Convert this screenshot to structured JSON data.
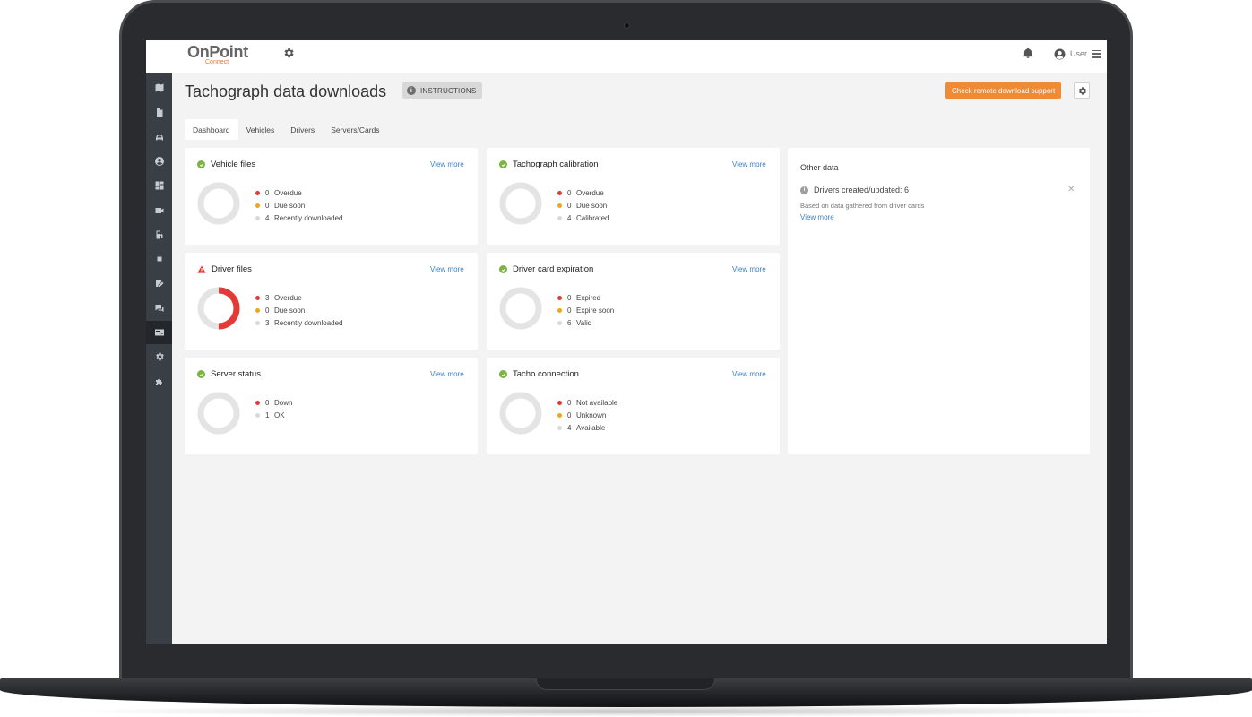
{
  "app": {
    "logo_main": "OnPoint",
    "logo_sub": "Connect"
  },
  "topbar": {
    "user_label": "User"
  },
  "sidebar": {
    "items": [
      {
        "name": "map-icon"
      },
      {
        "name": "document-icon"
      },
      {
        "name": "car-icon"
      },
      {
        "name": "person-icon"
      },
      {
        "name": "dashboard-icon"
      },
      {
        "name": "video-icon"
      },
      {
        "name": "fuel-icon"
      },
      {
        "name": "chip-icon"
      },
      {
        "name": "edit-icon"
      },
      {
        "name": "chat-icon"
      },
      {
        "name": "tachograph-icon",
        "active": true
      },
      {
        "name": "gear-icon"
      },
      {
        "name": "puzzle-icon"
      }
    ]
  },
  "page": {
    "title": "Tachograph data downloads",
    "instructions_label": "INSTRUCTIONS",
    "remote_button_label": "Check remote download support"
  },
  "tabs": [
    {
      "label": "Dashboard",
      "active": true
    },
    {
      "label": "Vehicles",
      "active": false
    },
    {
      "label": "Drivers",
      "active": false
    },
    {
      "label": "Servers/Cards",
      "active": false
    }
  ],
  "colors": {
    "red": "#e53935",
    "amber": "#f2a516",
    "grey": "#d9d9d9",
    "ring": "#e4e4e4",
    "ok": "#7cb342",
    "accent": "#ef8a35",
    "link": "#3d82c4"
  },
  "cards": [
    {
      "title": "Vehicle files",
      "status": "ok",
      "view_more": "View more",
      "legend": [
        {
          "value": 0,
          "label": "Overdue",
          "color": "red"
        },
        {
          "value": 0,
          "label": "Due soon",
          "color": "amber"
        },
        {
          "value": 4,
          "label": "Recently downloaded",
          "color": "grey"
        }
      ]
    },
    {
      "title": "Tachograph calibration",
      "status": "ok",
      "view_more": "View more",
      "legend": [
        {
          "value": 0,
          "label": "Overdue",
          "color": "red"
        },
        {
          "value": 0,
          "label": "Due soon",
          "color": "amber"
        },
        {
          "value": 4,
          "label": "Calibrated",
          "color": "grey"
        }
      ]
    },
    {
      "title": "Driver files",
      "status": "warning",
      "view_more": "View more",
      "legend": [
        {
          "value": 3,
          "label": "Overdue",
          "color": "red"
        },
        {
          "value": 0,
          "label": "Due soon",
          "color": "amber"
        },
        {
          "value": 3,
          "label": "Recently downloaded",
          "color": "grey"
        }
      ]
    },
    {
      "title": "Driver card expiration",
      "status": "ok",
      "view_more": "View more",
      "legend": [
        {
          "value": 0,
          "label": "Expired",
          "color": "red"
        },
        {
          "value": 0,
          "label": "Expire soon",
          "color": "amber"
        },
        {
          "value": 6,
          "label": "Valid",
          "color": "grey"
        }
      ]
    },
    {
      "title": "Server status",
      "status": "ok",
      "view_more": "View more",
      "legend": [
        {
          "value": 0,
          "label": "Down",
          "color": "red"
        },
        {
          "value": 1,
          "label": "OK",
          "color": "grey"
        }
      ]
    },
    {
      "title": "Tacho connection",
      "status": "ok",
      "view_more": "View more",
      "legend": [
        {
          "value": 0,
          "label": "Not available",
          "color": "red"
        },
        {
          "value": 0,
          "label": "Unknown",
          "color": "amber"
        },
        {
          "value": 4,
          "label": "Available",
          "color": "grey"
        }
      ]
    }
  ],
  "other_data": {
    "title": "Other data",
    "item_label": "Drivers created/updated: 6",
    "item_sub": "Based on data gathered from driver cards",
    "item_link": "View more"
  }
}
